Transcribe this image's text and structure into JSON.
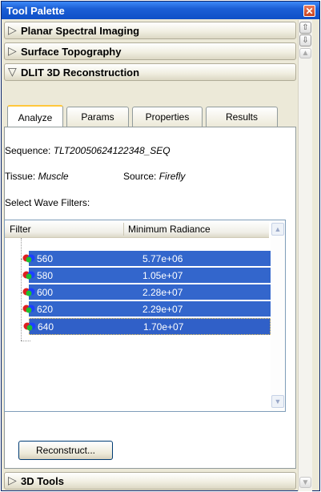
{
  "window": {
    "title": "Tool Palette"
  },
  "sections": [
    {
      "label": "Planar Spectral Imaging",
      "expanded": false
    },
    {
      "label": "Surface Topography",
      "expanded": false
    },
    {
      "label": "DLIT 3D Reconstruction",
      "expanded": true
    },
    {
      "label": "3D Tools",
      "expanded": false
    }
  ],
  "tabs": [
    "Analyze",
    "Params",
    "Properties",
    "Results"
  ],
  "analyze": {
    "sequence_label": "Sequence:",
    "sequence_value": "TLT20050624122348_SEQ",
    "tissue_label": "Tissue:",
    "tissue_value": "Muscle",
    "source_label": "Source:",
    "source_value": "Firefly",
    "wave_filters_label": "Select Wave Filters:"
  },
  "filters_table": {
    "columns": [
      "Filter",
      "Minimum Radiance"
    ],
    "rows": [
      {
        "filter": "560",
        "radiance": "5.77e+06",
        "selected": true
      },
      {
        "filter": "580",
        "radiance": "1.05e+07",
        "selected": true
      },
      {
        "filter": "600",
        "radiance": "2.28e+07",
        "selected": true
      },
      {
        "filter": "620",
        "radiance": "2.29e+07",
        "selected": true
      },
      {
        "filter": "640",
        "radiance": "1.70e+07",
        "selected": true
      }
    ]
  },
  "reconstruct_button": "Reconstruct...",
  "icons": {
    "close": "close-icon",
    "collapsed": "triangle-right-icon",
    "expanded": "triangle-down-icon",
    "filter": "rgb-filter-icon",
    "scroll_up": "chevron-up-icon",
    "scroll_down": "chevron-down-icon"
  },
  "colors": {
    "titlebar": "#1b5fd6",
    "selection": "#3366cc",
    "panel": "#ece9d8",
    "tab_highlight": "#ffc73c"
  }
}
